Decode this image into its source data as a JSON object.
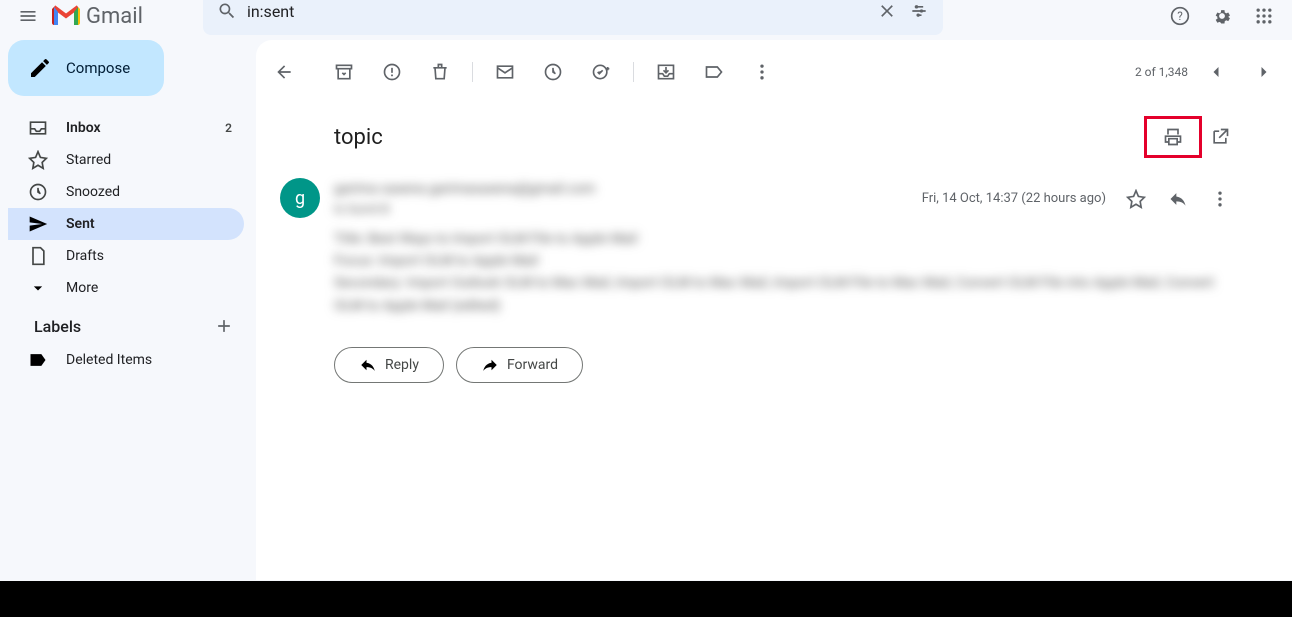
{
  "header": {
    "app_name": "Gmail",
    "search_value": "in:sent"
  },
  "sidebar": {
    "compose_label": "Compose",
    "items": [
      {
        "label": "Inbox",
        "count": "2"
      },
      {
        "label": "Starred"
      },
      {
        "label": "Snoozed"
      },
      {
        "label": "Sent"
      },
      {
        "label": "Drafts"
      },
      {
        "label": "More"
      }
    ],
    "labels_header": "Labels",
    "labels": [
      {
        "label": "Deleted Items"
      }
    ]
  },
  "toolbar": {
    "pager": "2 of 1,348"
  },
  "email": {
    "subject": "topic",
    "avatar_initial": "g",
    "timestamp": "Fri, 14 Oct, 14:37 (22 hours ago)",
    "reply_label": "Reply",
    "forward_label": "Forward",
    "blur": {
      "sender": "garima saxena  garimasaxena@gmail.com",
      "to": "to Sumit B",
      "line1": "Title: Best Ways to Import OLM File to Apple Mail",
      "line2": "Focus: Import OLM to Apple Mail",
      "line3": "Secondary: Import Outlook OLM to Mac Mail, Import OLM to Mac Mail, Import OLM File to Mac Mail, Convert OLM File into Apple Mail, Convert OLM to Apple Mail (edited)"
    }
  }
}
